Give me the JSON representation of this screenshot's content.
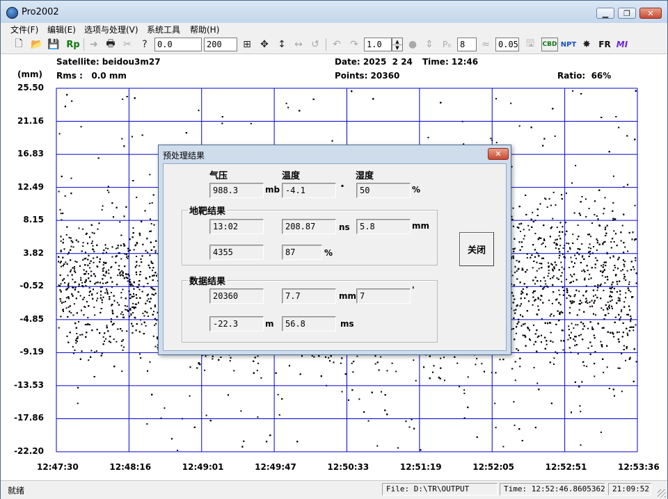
{
  "window": {
    "title": "Pro2002",
    "minimize": "▁",
    "maximize": "❐",
    "close": "✕"
  },
  "menu": [
    "文件(F)",
    "编辑(E)",
    "选项与处理(V)",
    "系统工具",
    "帮助(H)"
  ],
  "toolbar": {
    "rp_label": "Rp",
    "field1": "0.0",
    "field2": "200",
    "field3": "1.0",
    "field4": "8",
    "field5": "0.05",
    "icon_labels": {
      "cbd": "CBD",
      "npt": "NPT",
      "fr": "FR",
      "mi": "MI",
      "p0": "P₀"
    }
  },
  "header": {
    "satellite": "Satellite: beidou3m27",
    "rms": "Rms :   0.0 mm",
    "date": "Date: 2025  2 24",
    "time": "Time: 12:46",
    "points": "Points: 20360",
    "ratio": "Ratio:  66%",
    "unit": "(mm)"
  },
  "chart_data": {
    "type": "scatter",
    "y_ticks": [
      "25.50",
      "21.16",
      "16.83",
      "12.49",
      "8.15",
      "3.82",
      "-0.52",
      "-4.85",
      "-9.19",
      "-13.53",
      "-17.86",
      "-22.20"
    ],
    "x_ticks": [
      "12:47:30",
      "12:48:16",
      "12:49:01",
      "12:49:47",
      "12:50:33",
      "12:51:19",
      "12:52:05",
      "12:52:51",
      "12:53:36"
    ],
    "ylabel": "(mm)",
    "ylim": [
      -22.2,
      25.5
    ],
    "xlim": [
      "12:47:30",
      "12:53:36"
    ],
    "grid": true,
    "point_color": "#000000",
    "grid_color": "#0000cc"
  },
  "dialog": {
    "title": "预处理结果",
    "close_glyph": "✕",
    "pressure_label": "气压",
    "temp_label": "温度",
    "humidity_label": "湿度",
    "pressure": "988.3",
    "pressure_unit": "mb",
    "temp": "-4.1",
    "temp_mark": "·",
    "humidity": "50",
    "humidity_unit": "%",
    "target_group": "地靶结果",
    "target_time": "13:02",
    "target_range": "208.87",
    "target_range_unit": "ns",
    "target_dist": "5.8",
    "target_dist_unit": "mm",
    "target_count": "4355",
    "target_ratio": "87",
    "target_ratio_unit": "%",
    "data_group": "数据结果",
    "data_points": "20360",
    "data_rms": "7.7",
    "data_rms_unit": "mm",
    "data_val": "7",
    "data_mark": "'",
    "data_offset": "-22.3",
    "data_offset_unit": "m",
    "data_delay": "56.8",
    "data_delay_unit": "ms",
    "close_button": "关闭"
  },
  "status": {
    "text": "就绪",
    "file": "File: D:\\TR\\OUTPUT",
    "time": "Time: 12:52:46.8605362",
    "clock": "21:09:52"
  }
}
